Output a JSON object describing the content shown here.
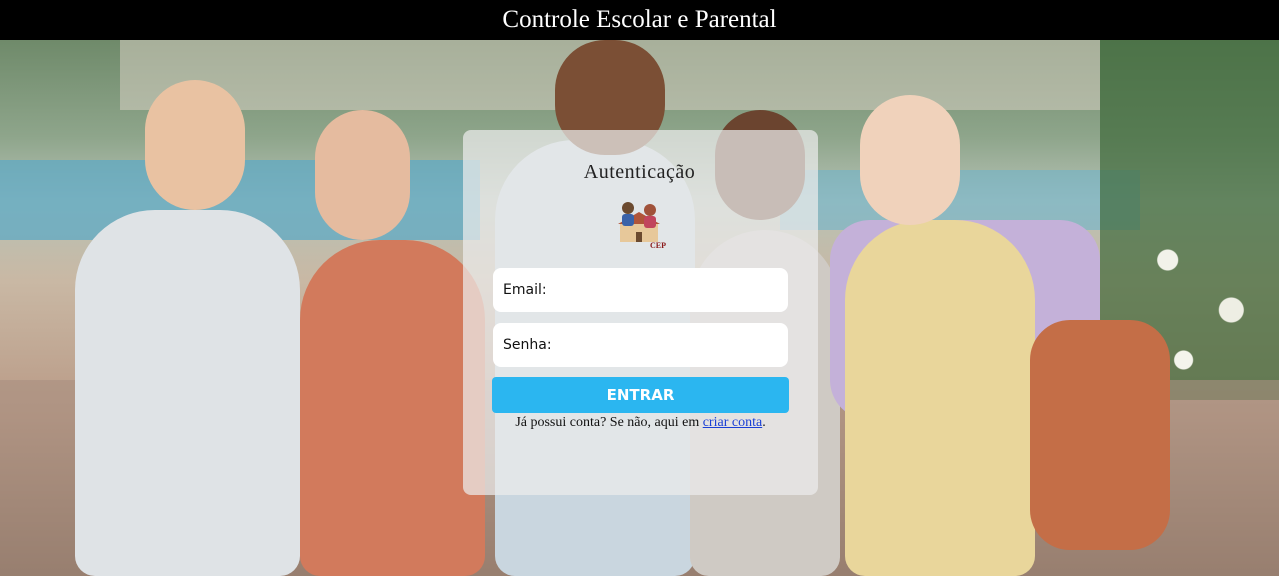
{
  "header": {
    "title": "Controle Escolar e Parental"
  },
  "login": {
    "title": "Autenticação",
    "logo_text": "CEP",
    "email_label": "Email:",
    "email_value": "",
    "password_label": "Senha:",
    "password_value": "",
    "submit_label": "ENTRAR",
    "footer_prefix": "Já possui conta? Se não, aqui em ",
    "footer_link": "criar conta",
    "footer_suffix": "."
  },
  "colors": {
    "header_bg": "#000000",
    "button_bg": "#2bb6f0",
    "link": "#1a3fd6"
  }
}
